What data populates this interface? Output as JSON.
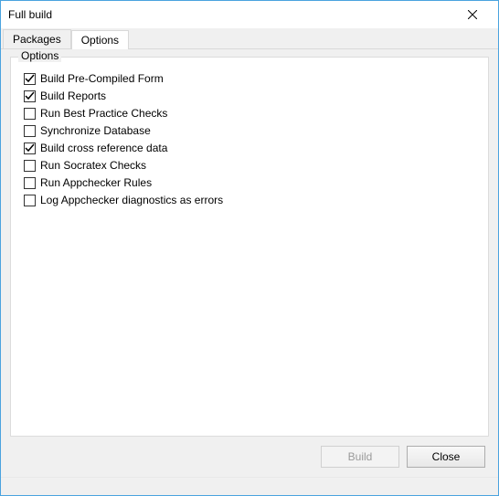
{
  "window": {
    "title": "Full build"
  },
  "tabs": [
    {
      "label": "Packages",
      "active": false
    },
    {
      "label": "Options",
      "active": true
    }
  ],
  "groupbox": {
    "label": "Options"
  },
  "options": [
    {
      "label": "Build Pre-Compiled Form",
      "checked": true
    },
    {
      "label": "Build Reports",
      "checked": true
    },
    {
      "label": "Run Best Practice Checks",
      "checked": false
    },
    {
      "label": "Synchronize Database",
      "checked": false
    },
    {
      "label": "Build cross reference data",
      "checked": true
    },
    {
      "label": "Run Socratex Checks",
      "checked": false
    },
    {
      "label": "Run Appchecker Rules",
      "checked": false
    },
    {
      "label": "Log Appchecker diagnostics as errors",
      "checked": false
    }
  ],
  "buttons": {
    "build": {
      "label": "Build",
      "enabled": false
    },
    "close": {
      "label": "Close",
      "enabled": true
    }
  }
}
